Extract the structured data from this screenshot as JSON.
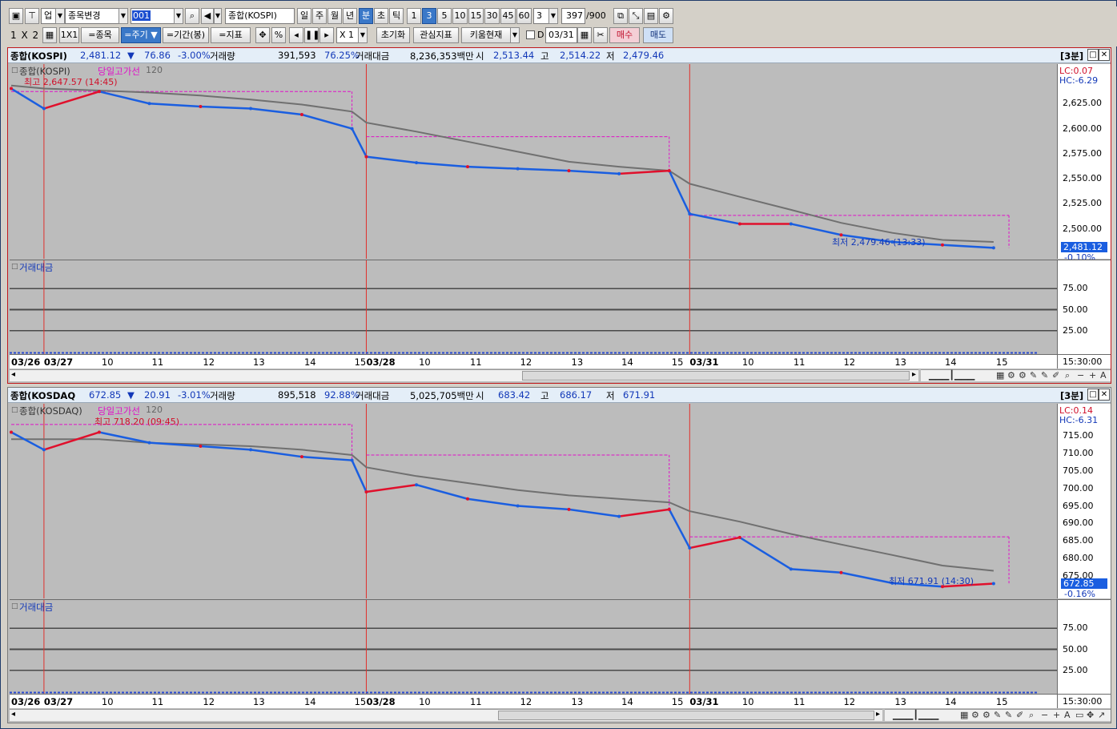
{
  "toolbar1": {
    "market_code": "업",
    "change_symbol": "종목변경",
    "code_value": "001",
    "search_name": "종합(KOSPI)",
    "period_day": "일",
    "period_week": "주",
    "period_month": "월",
    "period_year": "년",
    "period_minute": "분",
    "period_second": "초",
    "period_tick": "틱",
    "minute_options": [
      "1",
      "3",
      "5",
      "10",
      "15",
      "30",
      "45",
      "60"
    ],
    "selected_minute": "3",
    "interval_value": "3",
    "count_value": "397",
    "count_max": "/900"
  },
  "toolbar2": {
    "layout_label": "1 X 2",
    "grid_1x1": "1X1",
    "symbol_btn": "=종목",
    "period_btn": "=주기",
    "range_btn": "=기간(봉)",
    "indicator_btn": "=지표",
    "percent": "%",
    "zoom_value": "X 1",
    "reset_btn": "초기화",
    "interest_btn": "관심지표",
    "kiwoom_btn": "키움현재",
    "date_check_label": "D",
    "date_value": "03/31",
    "buy_btn": "매수",
    "sell_btn": "매도"
  },
  "colors": {
    "up": "#e0102c",
    "down": "#1a5ee0",
    "ma": "#707070",
    "high_line": "#e010c8",
    "panel_border_active": "#c0181c"
  },
  "panels": [
    {
      "id": "kospi",
      "name": "종합(KOSPI)",
      "price": "2,481.12",
      "change": "76.86",
      "change_pct": "-3.00%",
      "volume_label": "거래량",
      "volume": "391,593",
      "volume_pct": "76.25%",
      "amount_label": "거래대금",
      "amount": "8,236,353백만",
      "open_label": "시",
      "open": "2,513.44",
      "high_label": "고",
      "high": "2,514.22",
      "low_label": "저",
      "low": "2,479.46",
      "period_tag": "[3분]",
      "legend_name": "종합(KOSPI)",
      "legend_highline": "당일고가선",
      "legend_ma": "120",
      "max_label": "최고 2,647.57 (14:45)",
      "min_label": "최저 2,479.46 (13:33)",
      "lc_label": "LC:0.07",
      "hc_label": "HC:-6.29",
      "current_price_label": "2,481.12",
      "current_pct_label": "-0.10%",
      "y_ticks": [
        "2,625.00",
        "2,600.00",
        "2,575.00",
        "2,550.00",
        "2,525.00",
        "2,500.00"
      ],
      "sub_title": "거래대금",
      "sub_ticks": [
        "75.00",
        "50.00",
        "25.00"
      ],
      "time_label": "15:30:00",
      "x_labels": [
        "03/26",
        "03/27",
        "10",
        "11",
        "12",
        "13",
        "14",
        "15",
        "03/28",
        "10",
        "11",
        "12",
        "13",
        "14",
        "15",
        "03/31",
        "10",
        "11",
        "12",
        "13",
        "14",
        "15"
      ]
    },
    {
      "id": "kosdaq",
      "name": "종합(KOSDAQ",
      "price": "672.85",
      "change": "20.91",
      "change_pct": "-3.01%",
      "volume_label": "거래량",
      "volume": "895,518",
      "volume_pct": "92.88%",
      "amount_label": "거래대금",
      "amount": "5,025,705백만",
      "open_label": "시",
      "open": "683.42",
      "high_label": "고",
      "high": "686.17",
      "low_label": "저",
      "low": "671.91",
      "period_tag": "[3분]",
      "legend_name": "종합(KOSDAQ)",
      "legend_highline": "당일고가선",
      "legend_ma": "120",
      "max_label": "최고 718.20 (09:45)",
      "min_label": "최저 671.91 (14:30)",
      "lc_label": "LC:0.14",
      "hc_label": "HC:-6.31",
      "current_price_label": "672.85",
      "current_pct_label": "-0.16%",
      "y_ticks": [
        "715.00",
        "710.00",
        "705.00",
        "700.00",
        "695.00",
        "690.00",
        "685.00",
        "680.00",
        "675.00"
      ],
      "sub_title": "거래대금",
      "sub_ticks": [
        "75.00",
        "50.00",
        "25.00"
      ],
      "time_label": "15:30:00",
      "x_labels": [
        "03/26",
        "03/27",
        "10",
        "11",
        "12",
        "13",
        "14",
        "15",
        "03/28",
        "10",
        "11",
        "12",
        "13",
        "14",
        "15",
        "03/31",
        "10",
        "11",
        "12",
        "13",
        "14",
        "15"
      ]
    }
  ],
  "chart_data": [
    {
      "type": "line",
      "title": "종합(KOSPI)",
      "x": [
        "03/26 15:30",
        "03/27 09:00",
        "03/27 10:00",
        "03/27 11:00",
        "03/27 12:00",
        "03/27 13:00",
        "03/27 14:00",
        "03/27 15:30",
        "03/28 09:00",
        "03/28 10:00",
        "03/28 11:00",
        "03/28 12:00",
        "03/28 13:00",
        "03/28 14:00",
        "03/28 15:30",
        "03/31 09:00",
        "03/31 10:00",
        "03/31 11:00",
        "03/31 12:00",
        "03/31 13:00",
        "03/31 14:00",
        "03/31 15:30"
      ],
      "series": [
        {
          "name": "종합(KOSPI)",
          "values": [
            2640,
            2620,
            2637,
            2625,
            2622,
            2620,
            2614,
            2600,
            2572,
            2566,
            2562,
            2560,
            2558,
            2555,
            2558,
            2515,
            2505,
            2505,
            2494,
            2487,
            2484,
            2481.12
          ]
        },
        {
          "name": "120",
          "values": [
            2643,
            2640,
            2638,
            2636,
            2633,
            2629,
            2624,
            2617,
            2606,
            2597,
            2587,
            2577,
            2567,
            2562,
            2558,
            2545,
            2532,
            2519,
            2506,
            2496,
            2489,
            2487
          ]
        }
      ],
      "ylim": [
        2475,
        2650
      ],
      "day_high_lines": [
        2637,
        2592,
        2513.44
      ],
      "sub_chart": {
        "title": "거래대금",
        "ylim": [
          0,
          100
        ]
      }
    },
    {
      "type": "line",
      "title": "종합(KOSDAQ",
      "x": [
        "03/26 15:30",
        "03/27 09:00",
        "03/27 10:00",
        "03/27 11:00",
        "03/27 12:00",
        "03/27 13:00",
        "03/27 14:00",
        "03/27 15:30",
        "03/28 09:00",
        "03/28 10:00",
        "03/28 11:00",
        "03/28 12:00",
        "03/28 13:00",
        "03/28 14:00",
        "03/28 15:30",
        "03/31 09:00",
        "03/31 10:00",
        "03/31 11:00",
        "03/31 12:00",
        "03/31 13:00",
        "03/31 14:00",
        "03/31 15:30"
      ],
      "series": [
        {
          "name": "종합(KOSDAQ)",
          "values": [
            716,
            711,
            716,
            713,
            712,
            711,
            709,
            708,
            699,
            701,
            697,
            695,
            694,
            692,
            694,
            683,
            686,
            677,
            676,
            673,
            672,
            672.85
          ]
        },
        {
          "name": "120",
          "values": [
            714,
            714,
            714,
            713,
            712.5,
            712,
            711,
            709.5,
            706,
            703.5,
            701.5,
            699.5,
            698,
            697,
            696,
            693.5,
            690.5,
            687,
            684,
            681,
            678,
            676.5
          ]
        }
      ],
      "ylim": [
        670,
        720
      ],
      "day_high_lines": [
        718.2,
        709.5,
        686.17
      ],
      "sub_chart": {
        "title": "거래대금",
        "ylim": [
          0,
          100
        ]
      }
    }
  ]
}
